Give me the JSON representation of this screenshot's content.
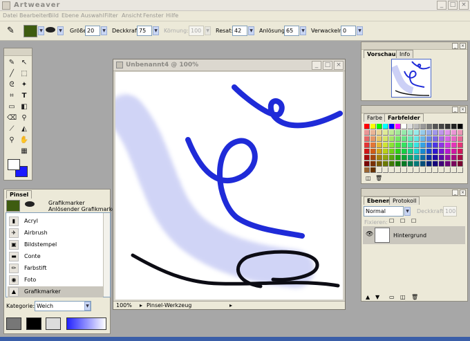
{
  "app": {
    "title": "Artweaver",
    "min": "_",
    "max": "□",
    "close": "×"
  },
  "menu": [
    "Datei",
    "Bearbeiten",
    "Bild",
    "Ebene",
    "Auswahl",
    "Filter",
    "Ansicht",
    "Fenster",
    "Hilfe"
  ],
  "options": {
    "groesse_label": "Größe:",
    "groesse": "20",
    "deckkraft_label": "Deckkraft:",
    "deckkraft": "75",
    "koernung_label": "Körnung:",
    "koernung": "100",
    "resat_label": "Resat:",
    "resat": "42",
    "aufloesung_label": "Anlösung:",
    "aufloesung": "65",
    "verwackeln_label": "Verwackeln:",
    "verwackeln": "0"
  },
  "document": {
    "title": "Unbenannt4 @ 100%",
    "zoom": "100%",
    "status": "Pinsel-Werkzeug"
  },
  "pinsel": {
    "title": "Pinsel",
    "category_name": "Grafikmarker",
    "variant": "Anlösender Grafikmarker",
    "brushes": [
      "Acryl",
      "Airbrush",
      "Bildstempel",
      "Conte",
      "Farbstift",
      "Foto",
      "Grafikmarker"
    ],
    "kategorie_label": "Kategorie:",
    "kategorie": "Weich"
  },
  "vorschau": {
    "tab1": "Vorschau",
    "tab2": "Info"
  },
  "farben": {
    "tab1": "Farbe",
    "tab2": "Farbfelder"
  },
  "ebenen": {
    "tab1": "Ebenen",
    "tab2": "Protokoll",
    "mode": "Normal",
    "deckkraft_label": "Deckkraft:",
    "deckkraft": "100",
    "fixieren_label": "Fixieren:",
    "layer_name": "Hintergrund"
  },
  "colors": {
    "foreground": "#ffffff",
    "background": "#1a1aff",
    "stroke_blue": "#1f2bd8",
    "stroke_black": "#0c0c14"
  }
}
